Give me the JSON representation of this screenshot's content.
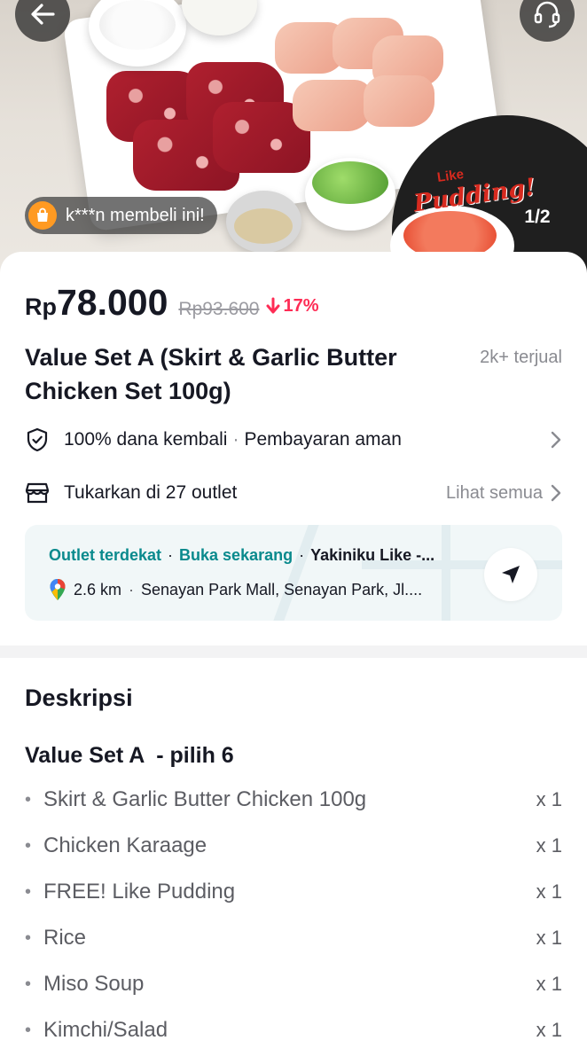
{
  "hero": {
    "promo_small": "Like",
    "promo_big": "Pudding!",
    "recent_buyer_text": "k***n membeli ini!",
    "slide_indicator": "1/2"
  },
  "product": {
    "currency": "Rp",
    "price": "78.000",
    "original_price": "Rp93.600",
    "discount": "17%",
    "title": "Value Set A (Skirt & Garlic Butter Chicken Set 100g)",
    "sold": "2k+ terjual"
  },
  "guarantee": {
    "refund": "100% dana kembali",
    "payment": "Pembayaran aman"
  },
  "redeem": {
    "text": "Tukarkan di 27 outlet",
    "see_all": "Lihat semua"
  },
  "outlet": {
    "label_nearest": "Outlet terdekat",
    "label_open": "Buka sekarang",
    "name": "Yakiniku Like -...",
    "distance": "2.6 km",
    "address": "Senayan Park Mall, Senayan Park, Jl...."
  },
  "description": {
    "heading": "Deskripsi",
    "set_title": "Value Set A  - pilih 6",
    "items": [
      {
        "name": "Skirt & Garlic Butter Chicken 100g",
        "qty": "x 1"
      },
      {
        "name": "Chicken Karaage",
        "qty": "x 1"
      },
      {
        "name": "FREE! Like Pudding",
        "qty": "x 1"
      },
      {
        "name": "Rice",
        "qty": "x 1"
      },
      {
        "name": "Miso Soup",
        "qty": "x 1"
      },
      {
        "name": "Kimchi/Salad",
        "qty": "x 1"
      }
    ]
  },
  "icons": {
    "back": "arrow-left-icon",
    "support": "headset-icon",
    "buyer": "shopping-bag-icon",
    "discount": "arrow-down-icon",
    "guarantee": "shield-check-icon",
    "store": "store-icon",
    "location": "map-pin-icon",
    "navigate": "navigation-arrow-icon",
    "chevron": "chevron-right-icon"
  },
  "colors": {
    "accent_red": "#fe2c55",
    "teal": "#0a8a8d",
    "badge_orange": "#ff9a22"
  }
}
